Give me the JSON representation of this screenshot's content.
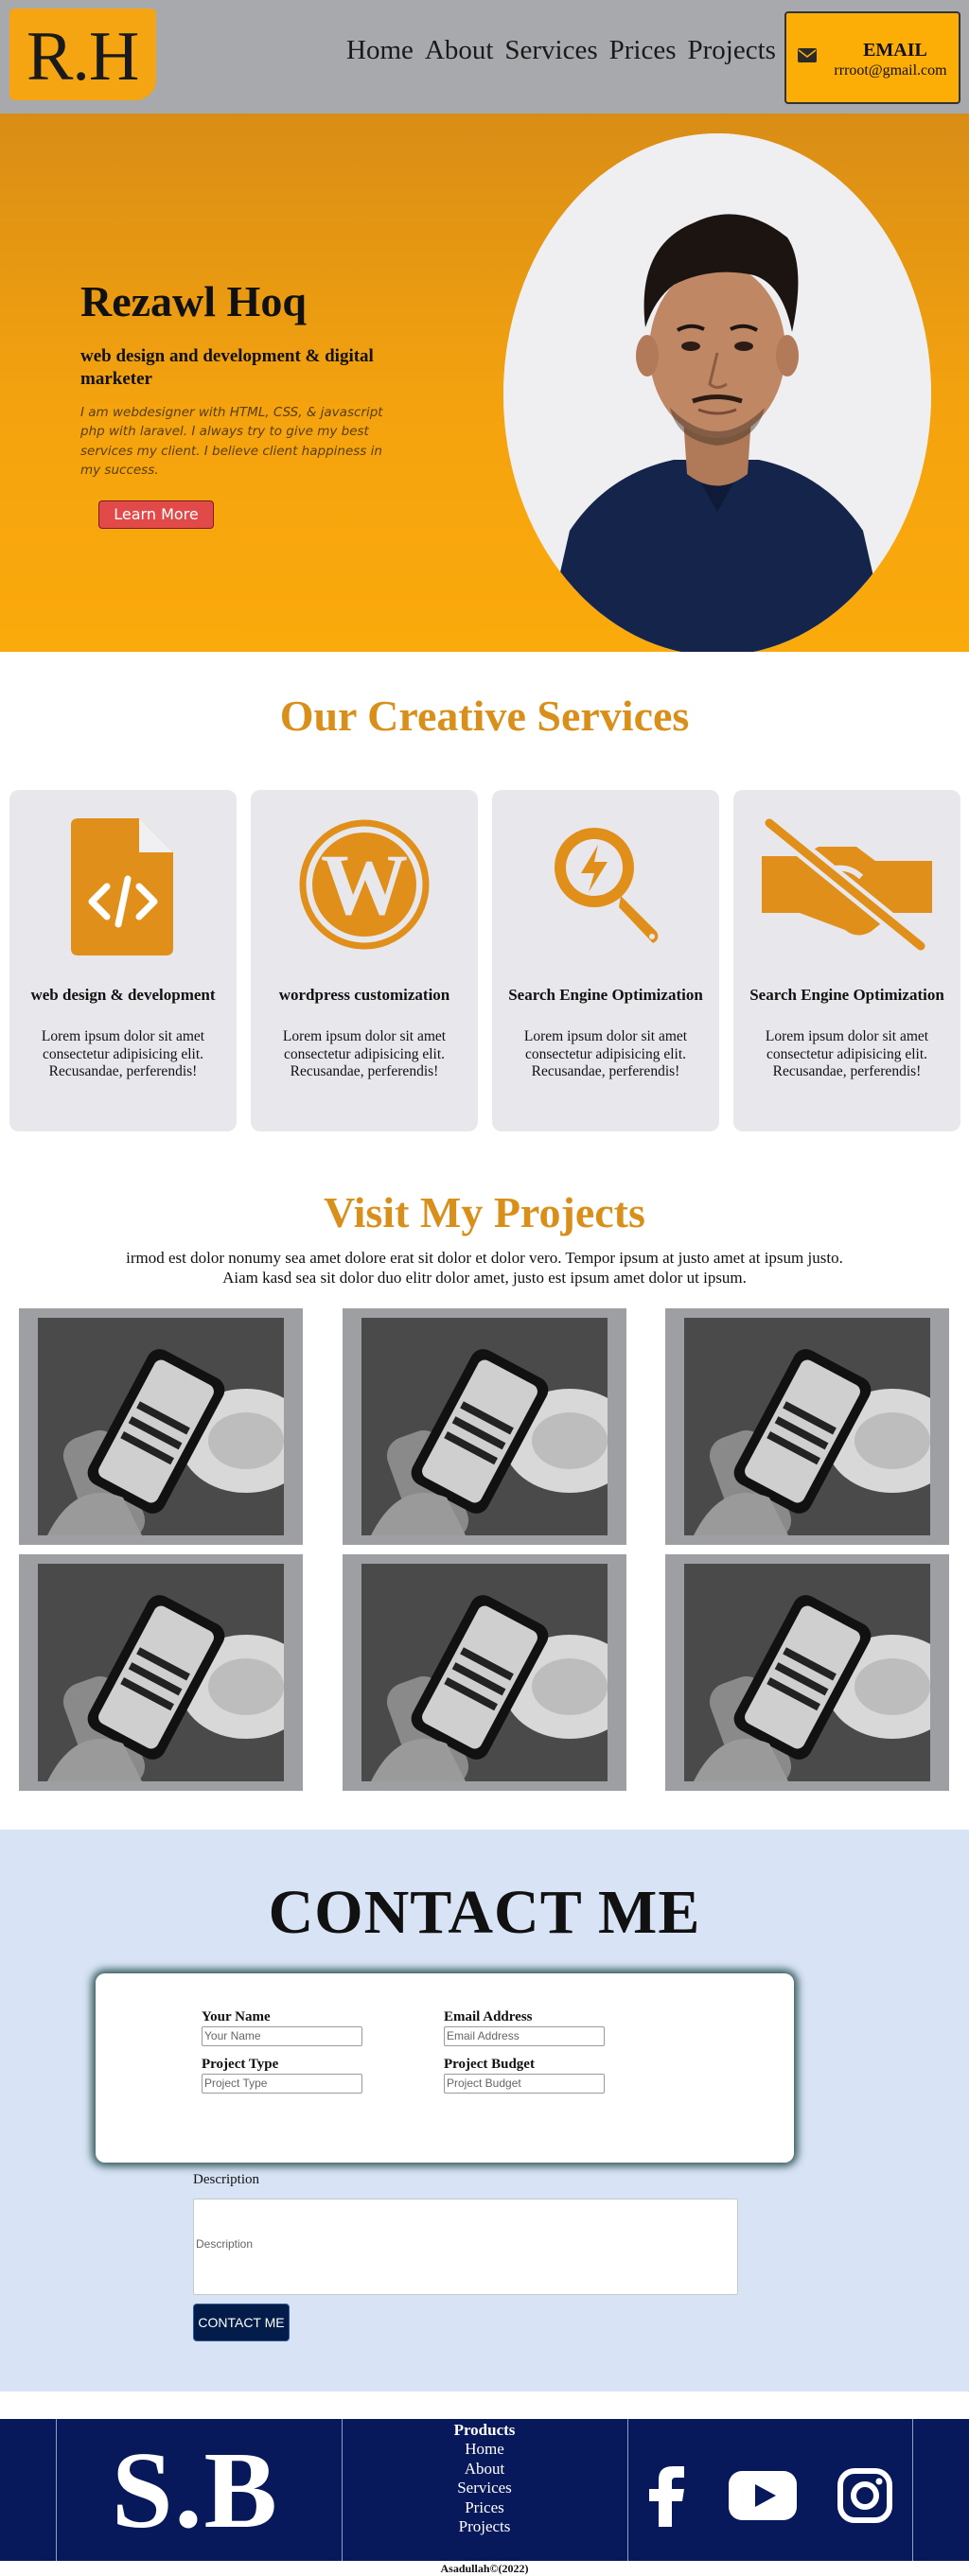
{
  "header": {
    "logo": "R.H",
    "nav": [
      "Home",
      "About",
      "Services",
      "Prices",
      "Projects"
    ],
    "email_title": "EMAIL",
    "email_address": "rrroot@gmail.com"
  },
  "hero": {
    "name": "Rezawl Hoq",
    "role": "web design and development & digital marketer",
    "description": "I am webdesigner with HTML, CSS, & javascript php with laravel. I always try to give my best services my client. I believe client happiness in my success.",
    "button": "Learn More"
  },
  "services": {
    "title": "Our Creative Services",
    "cards": [
      {
        "icon": "code-file-icon",
        "title": "web design & development",
        "text": "Lorem ipsum dolor sit amet consectetur adipisicing elit. Recusandae, perferendis!"
      },
      {
        "icon": "wordpress-icon",
        "title": "wordpress customization",
        "text": "Lorem ipsum dolor sit amet consectetur adipisicing elit. Recusandae, perferendis!"
      },
      {
        "icon": "search-bolt-icon",
        "title": "Search Engine Optimization",
        "text": "Lorem ipsum dolor sit amet consectetur adipisicing elit. Recusandae, perferendis!"
      },
      {
        "icon": "handshake-slash-icon",
        "title": "Search Engine Optimization",
        "text": "Lorem ipsum dolor sit amet consectetur adipisicing elit. Recusandae, perferendis!"
      }
    ]
  },
  "projects": {
    "title": "Visit My Projects",
    "text_line1": "irmod est dolor nonumy sea amet dolore erat sit dolor et dolor vero. Tempor ipsum at justo amet at ipsum justo.",
    "text_line2": "Aiam kasd sea sit dolor duo elitr dolor amet, justo est ipsum amet dolor ut ipsum."
  },
  "contact": {
    "title": "CONTACT ME",
    "name_label": "Your Name",
    "name_placeholder": "Your Name",
    "email_label": "Email Address",
    "email_placeholder": "Email Address",
    "type_label": "Project Type",
    "type_placeholder": "Project Type",
    "budget_label": "Project Budget",
    "budget_placeholder": "Project Budget",
    "description_label": "Description",
    "description_placeholder": "Description",
    "button": "CONTACT ME"
  },
  "footer": {
    "logo": "S.B",
    "links_title": "Products",
    "links": [
      "Home",
      "About",
      "Services",
      "Prices",
      "Projects"
    ],
    "social": [
      "facebook-icon",
      "youtube-icon",
      "instagram-icon"
    ],
    "copyright": "Asadullah©(2022)"
  },
  "colors": {
    "accent": "#d9901a",
    "hero_orange": "#f4a30e",
    "email_yellow": "#fdae06",
    "footer_navy": "#08195b",
    "contact_bg": "#d8e4f5"
  }
}
